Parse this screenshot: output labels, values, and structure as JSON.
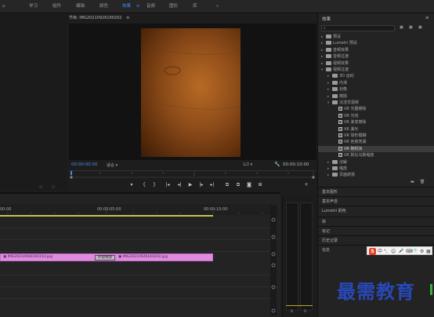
{
  "menu": {
    "items": [
      "学习",
      "组件",
      "编辑",
      "颜色",
      "效果",
      "音频",
      "图形",
      "库"
    ],
    "active": "效果",
    "more": "»"
  },
  "program_monitor": {
    "title": "节目: IMG20210926160202",
    "menu_icon": "≡",
    "timecode_current": "00:00:00:00",
    "fit_label": "适合",
    "resolution": "1/2",
    "timecode_duration": "00:00:10:00",
    "transport": [
      "▾",
      "{",
      "}",
      "|◂",
      "◂|",
      "▶",
      "|▸",
      "▸|",
      "⧉",
      "⧉",
      "◙",
      "⊞",
      "+"
    ]
  },
  "timeline": {
    "ruler_labels": [
      "00:00",
      "00:00:05:00",
      "00:00:10:00"
    ],
    "clip_a_label": "IMG20210926160154.jpg",
    "clip_b_label": "IMG20210926160202.jpg",
    "transition_label": "叶裂特效"
  },
  "effects_panel": {
    "title": "效果",
    "menu_icon": "≡",
    "search_placeholder": "",
    "tree": [
      {
        "label": "预设",
        "level": 0,
        "type": "folder"
      },
      {
        "label": "Lumetri 预设",
        "level": 0,
        "type": "folder"
      },
      {
        "label": "音频效果",
        "level": 0,
        "type": "folder"
      },
      {
        "label": "音频过渡",
        "level": 0,
        "type": "folder"
      },
      {
        "label": "视频效果",
        "level": 0,
        "type": "folder"
      },
      {
        "label": "视频过渡",
        "level": 0,
        "type": "folder",
        "open": true
      },
      {
        "label": "3D 运动",
        "level": 1,
        "type": "folder"
      },
      {
        "label": "内滑",
        "level": 1,
        "type": "folder"
      },
      {
        "label": "划像",
        "level": 1,
        "type": "folder"
      },
      {
        "label": "擦除",
        "level": 1,
        "type": "folder"
      },
      {
        "label": "沉浸式视频",
        "level": 1,
        "type": "folder",
        "open": true
      },
      {
        "label": "VR 光圈擦除",
        "level": 2,
        "type": "effect"
      },
      {
        "label": "VR 光线",
        "level": 2,
        "type": "effect"
      },
      {
        "label": "VR 渐变擦除",
        "level": 2,
        "type": "effect"
      },
      {
        "label": "VR 漏光",
        "level": 2,
        "type": "effect"
      },
      {
        "label": "VR 球形模糊",
        "level": 2,
        "type": "effect"
      },
      {
        "label": "VR 色度泄漏",
        "level": 2,
        "type": "effect"
      },
      {
        "label": "VR 随机块",
        "level": 2,
        "type": "effect",
        "selected": true
      },
      {
        "label": "VR 默比乌斯缩放",
        "level": 2,
        "type": "effect"
      },
      {
        "label": "溶解",
        "level": 1,
        "type": "folder"
      },
      {
        "label": "缩放",
        "level": 1,
        "type": "folder"
      },
      {
        "label": "页面剥落",
        "level": 1,
        "type": "folder"
      }
    ]
  },
  "side_panels": [
    "基本图形",
    "基本声音",
    "Lumetri 颜色",
    "库",
    "标记",
    "历史记录",
    "信息"
  ],
  "meter_labels": [
    "S",
    "S"
  ],
  "ime_bar": {
    "logo": "S",
    "items": [
      "中",
      "°,",
      "☺",
      "🎤",
      "⌨",
      "👕",
      "⚙",
      "▦"
    ]
  },
  "watermark": "最需教育",
  "colors": {
    "accent": "#3f8ff0",
    "clip": "#e08ae0",
    "watermark": "#2848b8",
    "playhead": "#3f8ff0"
  }
}
